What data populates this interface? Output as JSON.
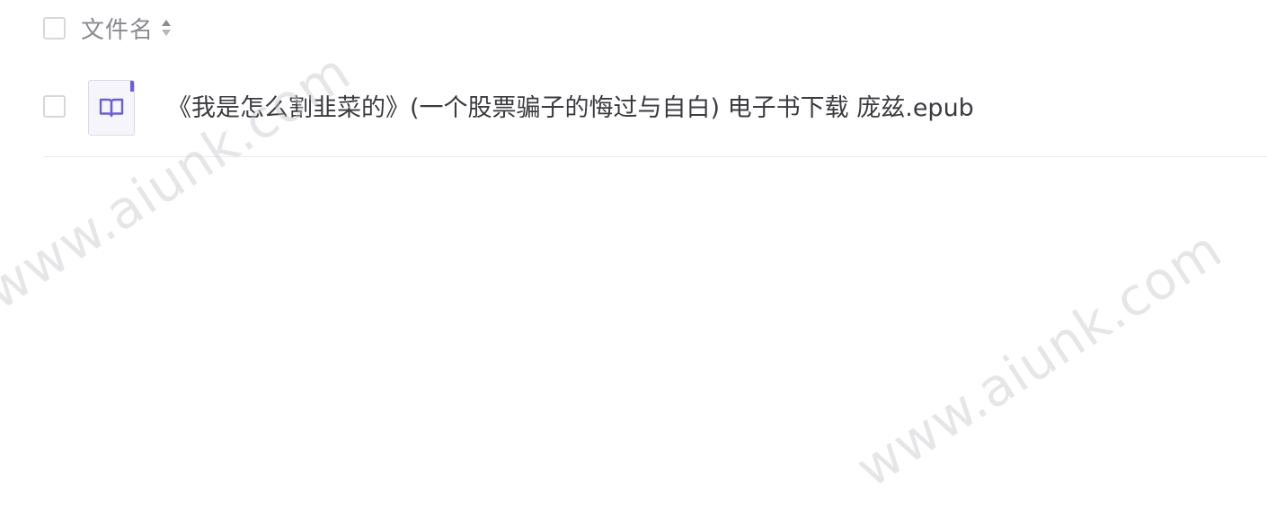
{
  "header": {
    "column_title": "文件名",
    "sort_icon": "sort-icon"
  },
  "files": [
    {
      "name": "《我是怎么割韭菜的》(一个股票骗子的悔过与自白) 电子书下载 庞兹.epub",
      "icon": "book-icon",
      "icon_color": "#6a5fd8"
    }
  ],
  "watermarks": [
    "www.aiunk.com",
    "www.aiunk.com"
  ]
}
